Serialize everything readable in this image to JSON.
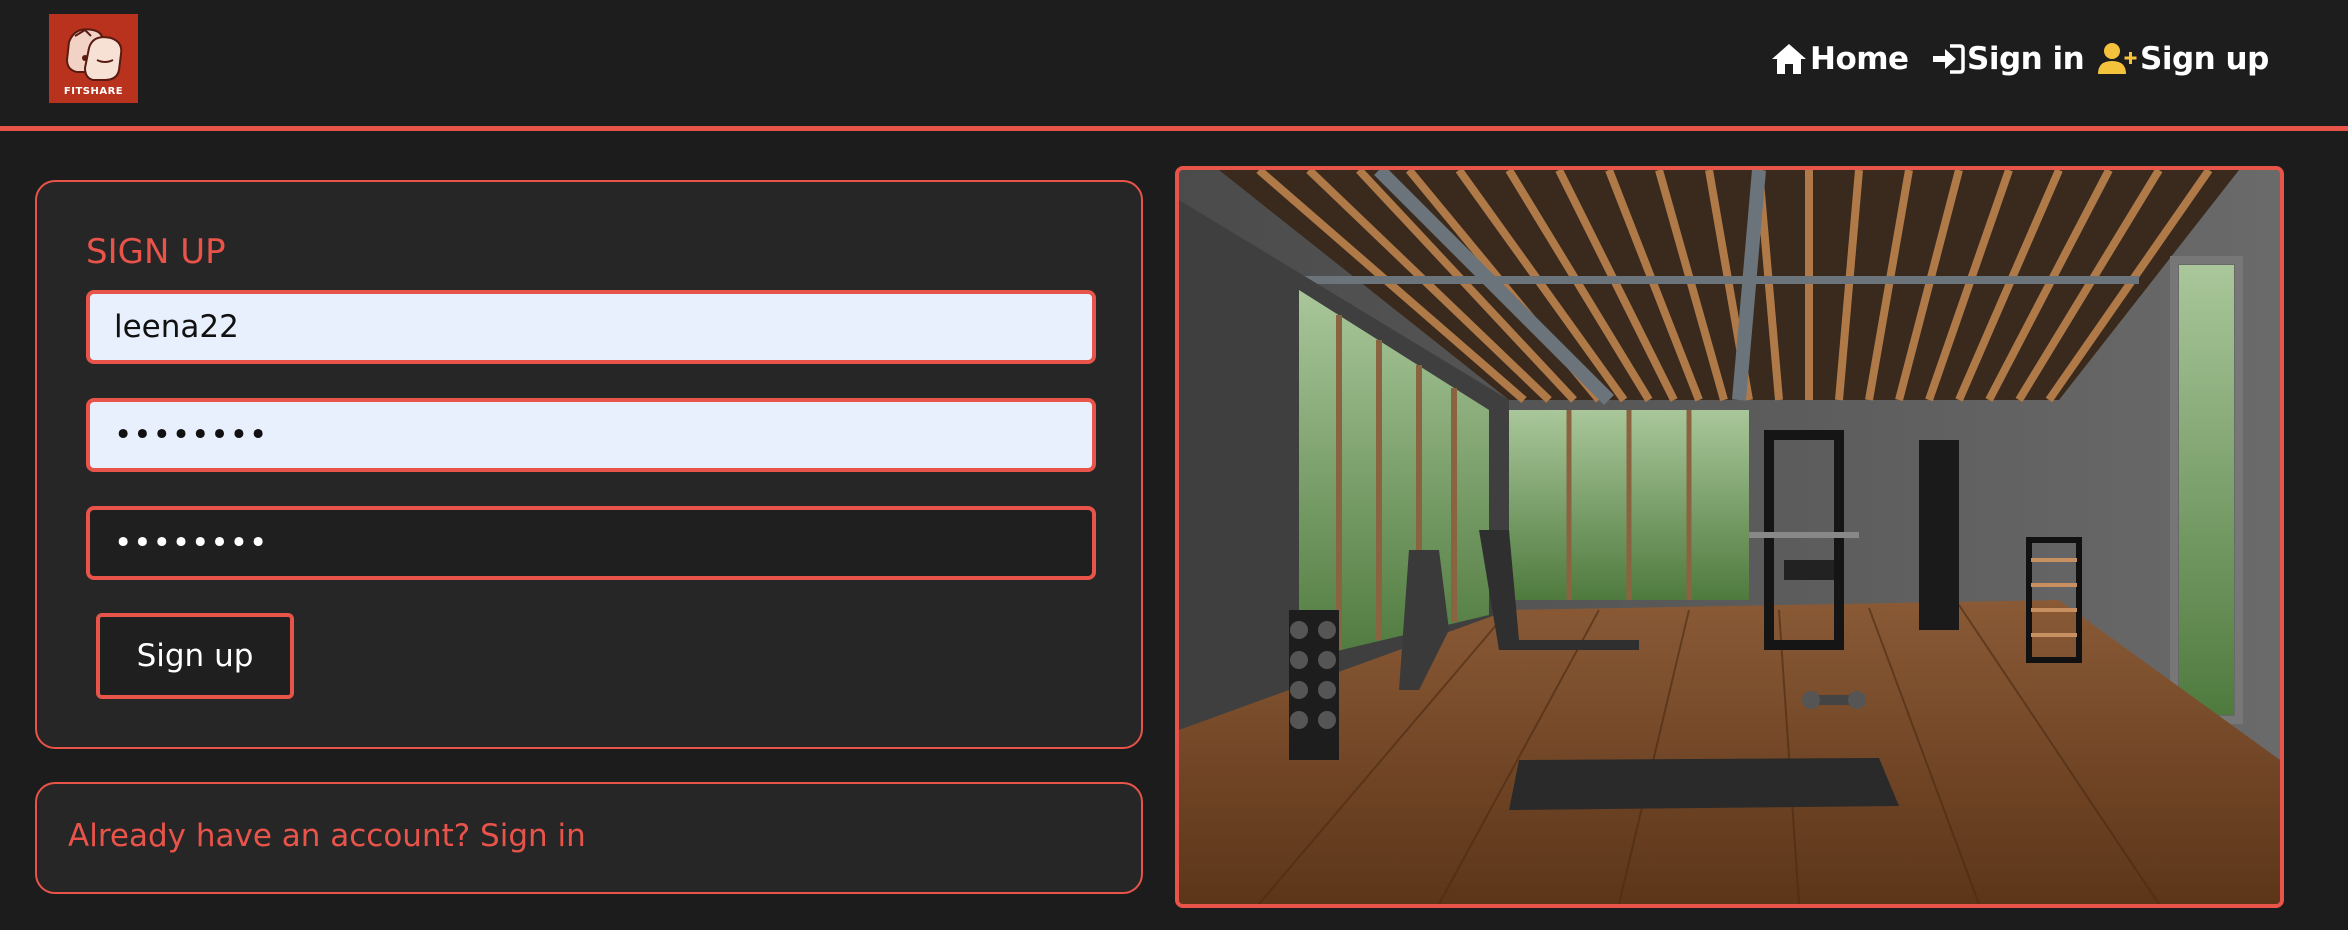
{
  "brand": {
    "logo_text": "FITSHARE",
    "accent_color": "#e8534a",
    "logo_bg": "#b8321e"
  },
  "nav": {
    "items": [
      {
        "label": "Home",
        "icon": "home-icon",
        "color": "#ffffff"
      },
      {
        "label": "Sign in",
        "icon": "sign-in-icon",
        "color": "#ffffff"
      },
      {
        "label": "Sign up",
        "icon": "user-plus-icon",
        "color": "#ffffff",
        "icon_color": "#f5c33b"
      }
    ]
  },
  "form": {
    "title": "SIGN UP",
    "username_value": "leena22",
    "password_value": "••••••••",
    "confirm_value": "••••••••",
    "submit_label": "Sign up"
  },
  "footer_card": {
    "link_text": "Already have an account? Sign in"
  },
  "hero": {
    "subject": "home gym interior with treadmills, weights and wooden floor"
  }
}
